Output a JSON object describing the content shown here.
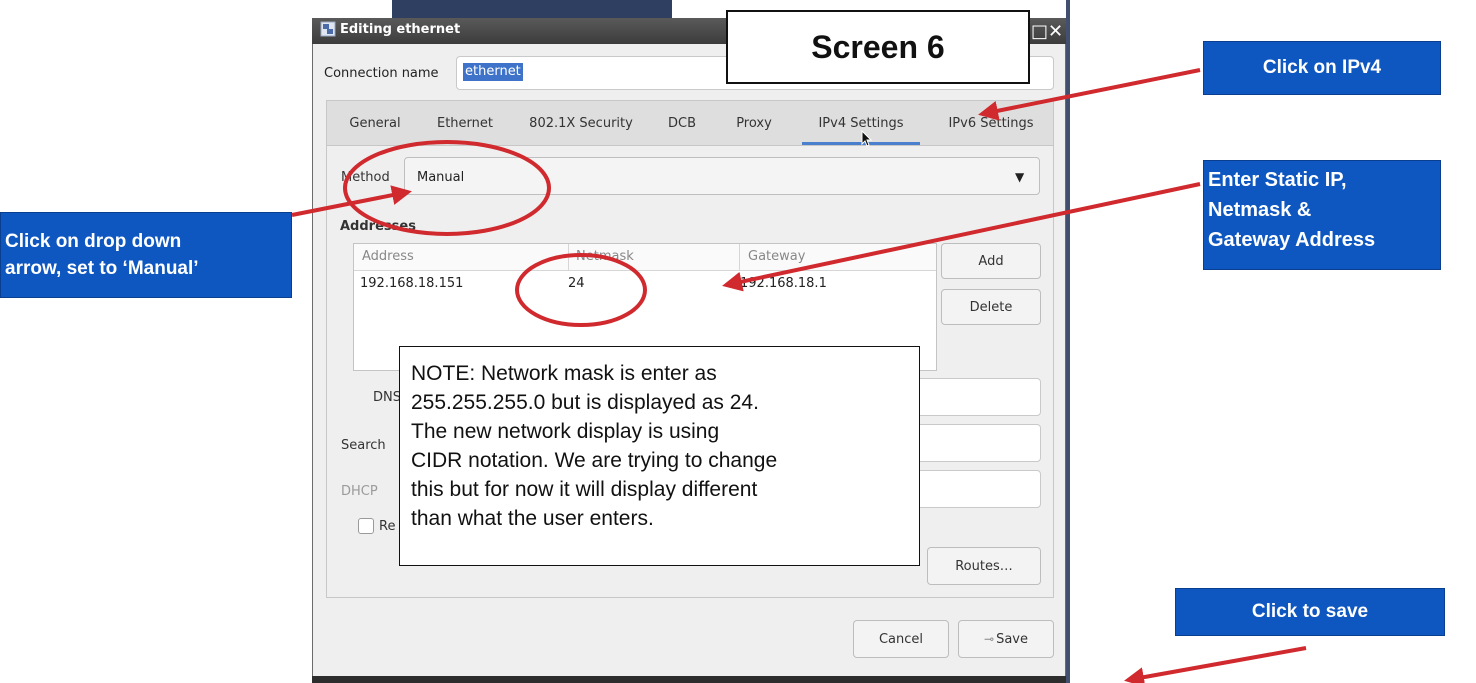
{
  "window": {
    "title": "Editing ethernet",
    "controls": "□✕"
  },
  "connection": {
    "label": "Connection name",
    "value": "ethernet"
  },
  "tabs": [
    {
      "label": "General"
    },
    {
      "label": "Ethernet"
    },
    {
      "label": "802.1X Security"
    },
    {
      "label": "DCB"
    },
    {
      "label": "Proxy"
    },
    {
      "label": "IPv4 Settings"
    },
    {
      "label": "IPv6 Settings"
    }
  ],
  "active_tab": "IPv4 Settings",
  "ipv4": {
    "method_label": "Method",
    "method_value": "Manual",
    "addresses_label": "Addresses",
    "columns": [
      "Address",
      "Netmask",
      "Gateway"
    ],
    "rows": [
      {
        "address": "192.168.18.151",
        "netmask": "24",
        "gateway": "192.168.18.1"
      }
    ],
    "add_label": "Add",
    "delete_label": "Delete",
    "dns_label": "DNS",
    "search_label": "Search",
    "dhcp_label": "DHCP",
    "checkbox_label": "Re",
    "routes_label": "Routes…"
  },
  "footer": {
    "cancel_label": "Cancel",
    "save_label": "Save"
  },
  "annotations": {
    "screen_title": "Screen 6",
    "click_ipv4": "Click on IPv4",
    "enter_static_lines": [
      "Enter Static IP,",
      "Netmask &",
      "Gateway Address"
    ],
    "dropdown_lines": [
      "Click on drop down",
      "arrow, set to ‘Manual’"
    ],
    "click_save": "Click to save",
    "note_lines": [
      "NOTE: Network mask is enter as",
      "255.255.255.0 but is displayed as 24.",
      "The new network display is using",
      "CIDR notation. We are trying to change",
      "this but for now it will display different",
      "than what the user enters."
    ]
  },
  "colors": {
    "callout_blue": "#0f57c0",
    "arrow_red": "#d0292e",
    "tab_underline": "#4a7fcd",
    "selection": "#3f73c9"
  }
}
